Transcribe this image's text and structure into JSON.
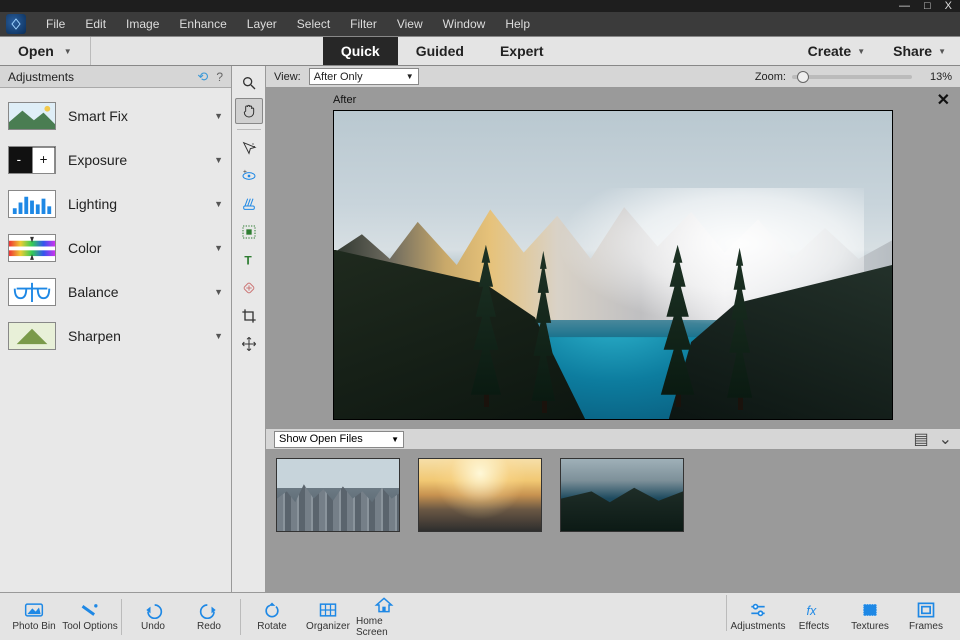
{
  "window_controls": {
    "min": "—",
    "max": "□",
    "close": "X"
  },
  "menu": [
    "File",
    "Edit",
    "Image",
    "Enhance",
    "Layer",
    "Select",
    "Filter",
    "View",
    "Window",
    "Help"
  ],
  "bar2": {
    "open": "Open",
    "tabs": [
      "Quick",
      "Guided",
      "Expert"
    ],
    "active_tab": "Quick",
    "create": "Create",
    "share": "Share"
  },
  "adjustments": {
    "title": "Adjustments",
    "items": [
      "Smart Fix",
      "Exposure",
      "Lighting",
      "Color",
      "Balance",
      "Sharpen"
    ]
  },
  "tools": [
    "zoom",
    "hand",
    "quick-select",
    "eye",
    "whiten",
    "redeye",
    "type",
    "spot",
    "crop",
    "move"
  ],
  "viewbar": {
    "view_label": "View:",
    "view_value": "After Only",
    "zoom_label": "Zoom:",
    "zoom_pct": "13%"
  },
  "canvas": {
    "label": "After"
  },
  "bin": {
    "selector": "Show Open Files",
    "thumbs": [
      "city",
      "beach",
      "mountain"
    ]
  },
  "bottom": {
    "left": [
      "Photo Bin",
      "Tool Options",
      "Undo",
      "Redo",
      "Rotate",
      "Organizer",
      "Home Screen"
    ],
    "right": [
      "Adjustments",
      "Effects",
      "Textures",
      "Frames"
    ]
  }
}
